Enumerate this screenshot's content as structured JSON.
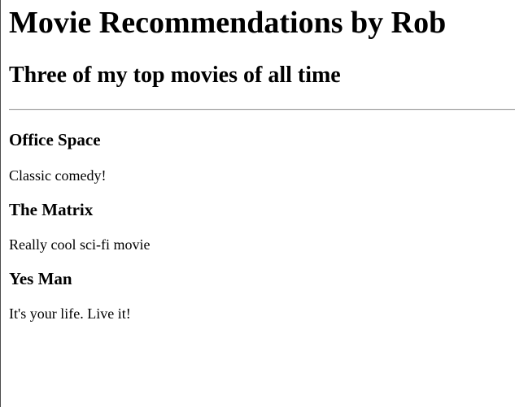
{
  "page": {
    "title": "Movie Recommendations by Rob",
    "subtitle": "Three of my top movies of all time"
  },
  "movies": [
    {
      "title": "Office Space",
      "description": "Classic comedy!"
    },
    {
      "title": "The Matrix",
      "description": "Really cool sci-fi movie"
    },
    {
      "title": "Yes Man",
      "description": "It's your life. Live it!"
    }
  ]
}
